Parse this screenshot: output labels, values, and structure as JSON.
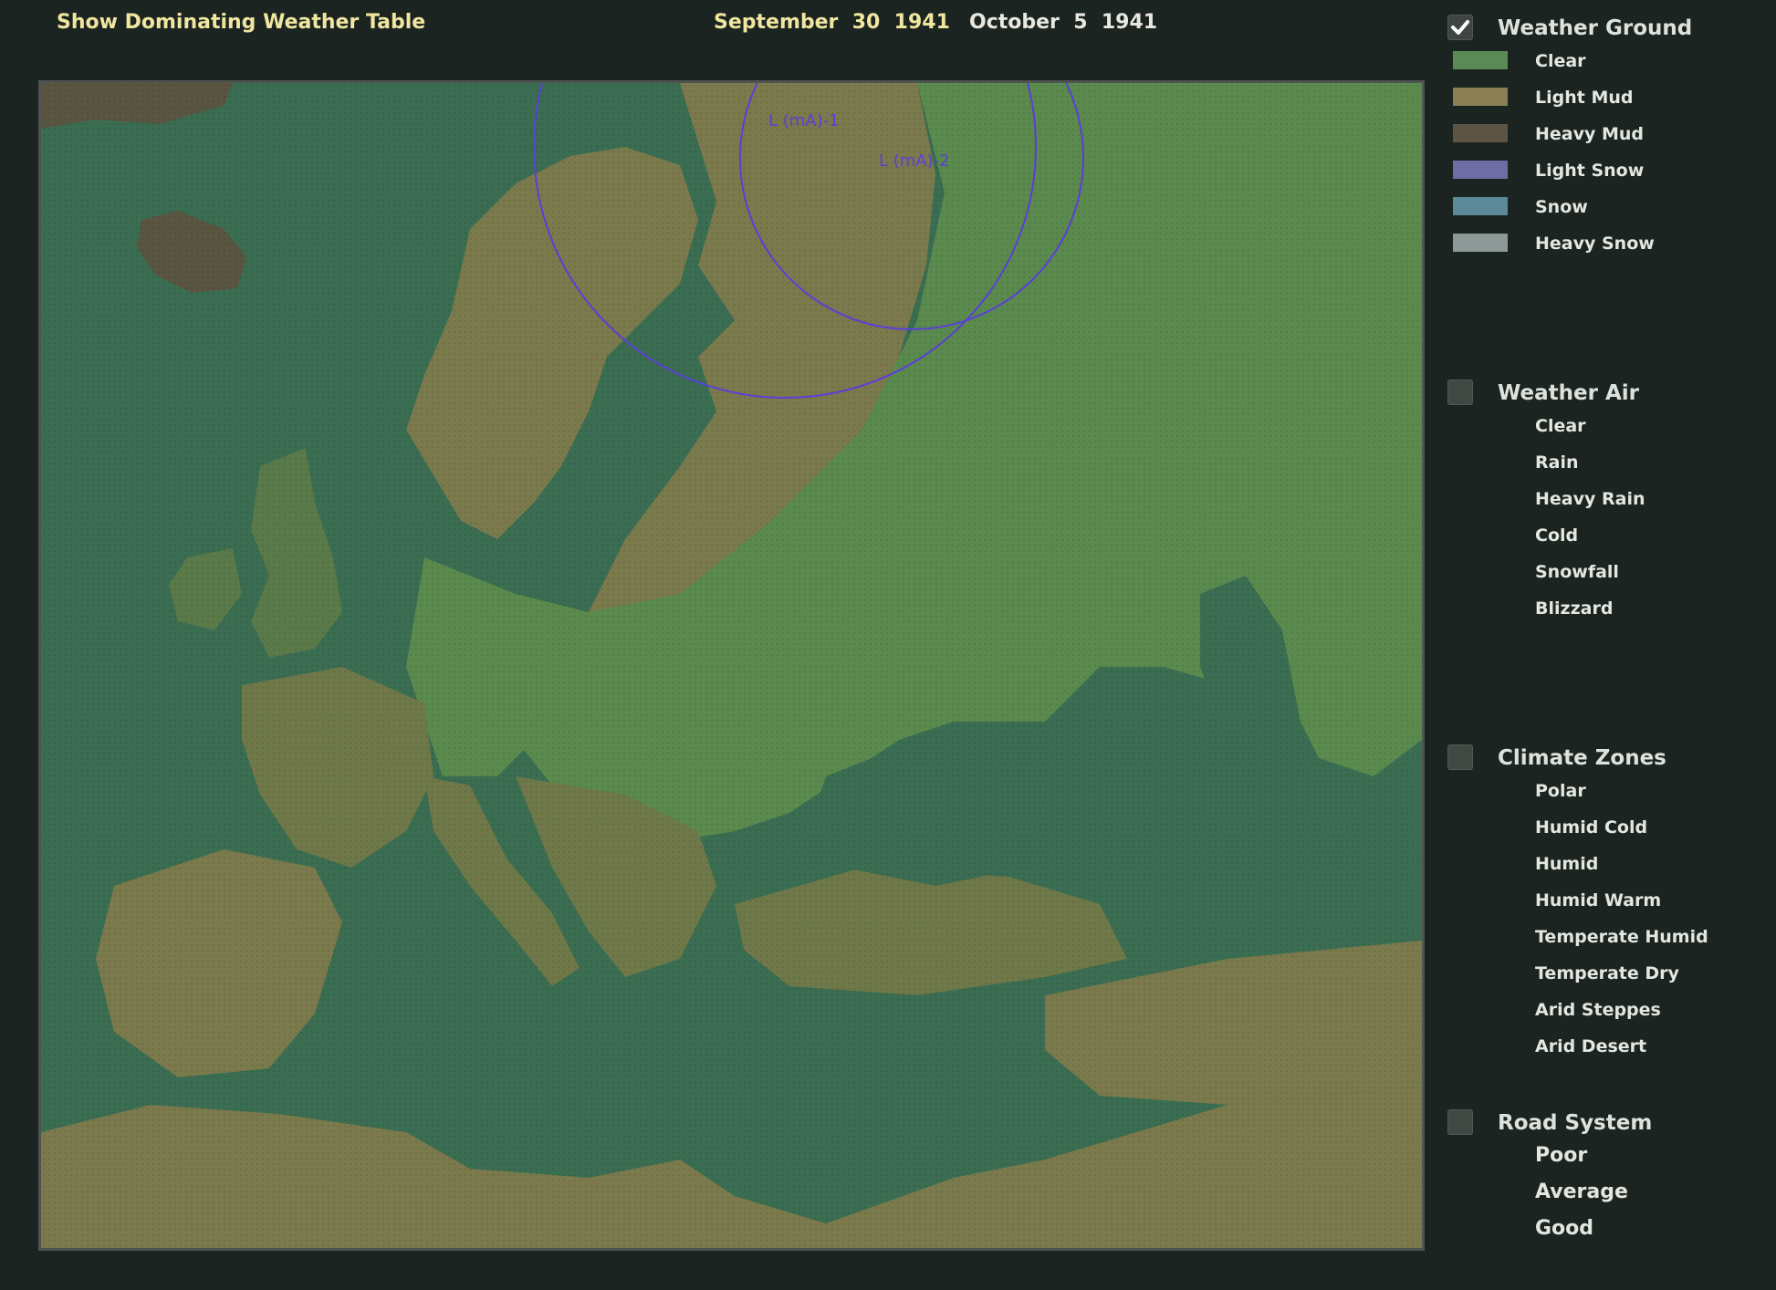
{
  "header": {
    "dominating_weather_link": "Show Dominating Weather Table",
    "date_start": "September  30  1941",
    "date_end": "October  5  1941"
  },
  "map": {
    "pressure_systems": [
      {
        "label": "L (mA)-1",
        "color": "#5b3fd8"
      },
      {
        "label": "L (mA)-2",
        "color": "#5b3fd8"
      }
    ]
  },
  "legend": {
    "weather_ground": {
      "title": "Weather Ground",
      "checked": true,
      "items": [
        {
          "label": "Clear",
          "color": "#5a8a55"
        },
        {
          "label": "Light Mud",
          "color": "#8a7f55"
        },
        {
          "label": "Heavy Mud",
          "color": "#5c5444"
        },
        {
          "label": "Light Snow",
          "color": "#6f6ea4"
        },
        {
          "label": "Snow",
          "color": "#5c8a98"
        },
        {
          "label": "Heavy Snow",
          "color": "#8c9996"
        }
      ]
    },
    "weather_air": {
      "title": "Weather Air",
      "checked": false,
      "items": [
        {
          "label": "Clear"
        },
        {
          "label": "Rain"
        },
        {
          "label": "Heavy Rain"
        },
        {
          "label": "Cold"
        },
        {
          "label": "Snowfall"
        },
        {
          "label": "Blizzard"
        }
      ]
    },
    "climate_zones": {
      "title": "Climate Zones",
      "checked": false,
      "items": [
        {
          "label": "Polar"
        },
        {
          "label": "Humid Cold"
        },
        {
          "label": "Humid"
        },
        {
          "label": "Humid Warm"
        },
        {
          "label": "Temperate Humid"
        },
        {
          "label": "Temperate Dry"
        },
        {
          "label": "Arid Steppes"
        },
        {
          "label": "Arid Desert"
        }
      ]
    },
    "road_system": {
      "title": "Road System",
      "checked": false,
      "items": [
        {
          "label": "Poor"
        },
        {
          "label": "Average"
        },
        {
          "label": "Good"
        }
      ]
    }
  },
  "colors": {
    "sea": "#3a6d52",
    "clear_land": "#5a8a4d",
    "light_mud_land": "#7a7a4c",
    "heavy_mud_land": "#595541"
  }
}
